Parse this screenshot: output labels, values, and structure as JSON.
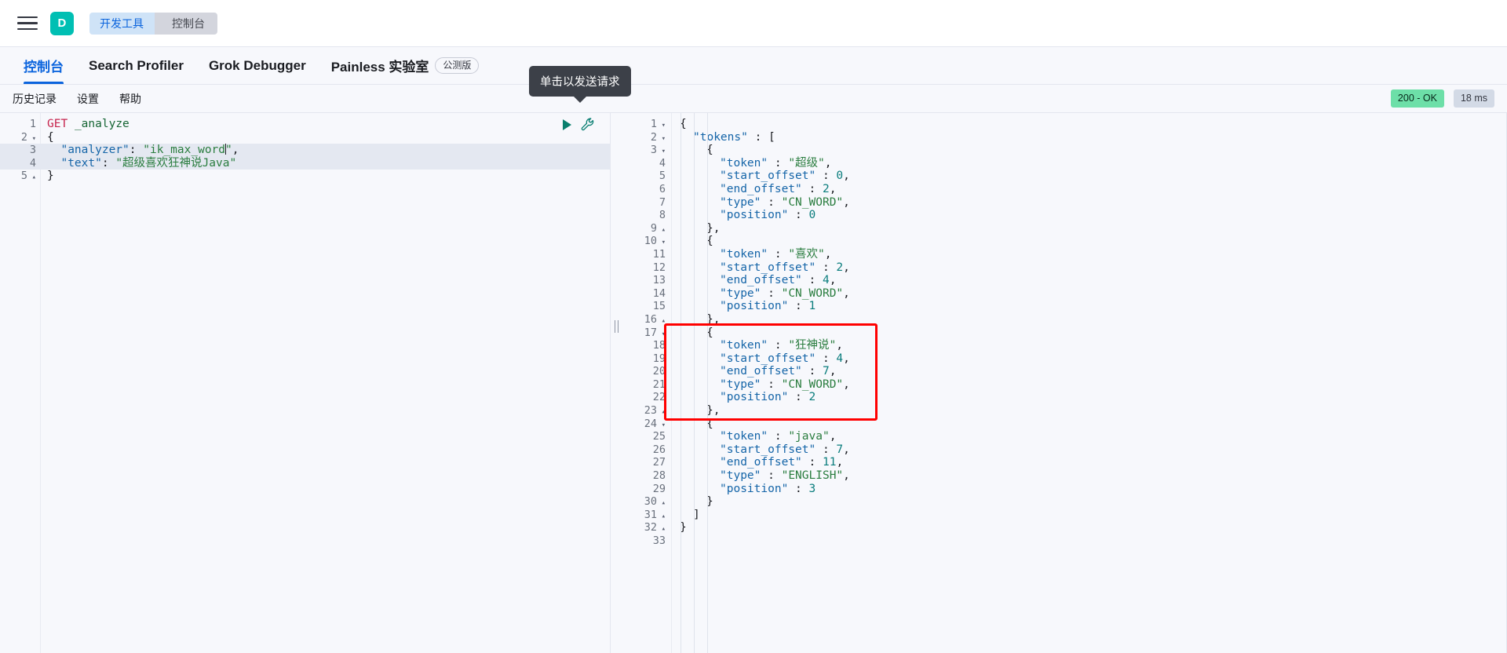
{
  "chrome": {
    "menu_icon": "hamburger-menu-icon",
    "avatar_initial": "D",
    "breadcrumbs": [
      {
        "label": "开发工具",
        "active": true
      },
      {
        "label": "控制台",
        "active": false
      }
    ]
  },
  "app_tabs": [
    {
      "label": "控制台",
      "active": true,
      "badge": ""
    },
    {
      "label": "Search Profiler",
      "active": false,
      "badge": ""
    },
    {
      "label": "Grok Debugger",
      "active": false,
      "badge": ""
    },
    {
      "label": "Painless 实验室",
      "active": false,
      "badge": "公测版"
    }
  ],
  "subbar": {
    "items": [
      {
        "label": "历史记录"
      },
      {
        "label": "设置"
      },
      {
        "label": "帮助"
      }
    ],
    "status_code": "200 - OK",
    "duration": "18 ms",
    "status_color": "#6ddfa8",
    "duration_color": "#d3dae6"
  },
  "tooltip": {
    "text": "单击以发送请求"
  },
  "editor_actions": {
    "play_label": "send-request",
    "wrench_label": "open-documentation"
  },
  "request_editor": {
    "lines": [
      {
        "n": "1",
        "fold": "",
        "hl": false,
        "segments": [
          {
            "t": "GET",
            "c": "k-method"
          },
          {
            "t": " ",
            "c": "k-punc"
          },
          {
            "t": "_analyze",
            "c": "k-url"
          }
        ]
      },
      {
        "n": "2",
        "fold": "▾",
        "hl": false,
        "segments": [
          {
            "t": "{",
            "c": "k-brace"
          }
        ]
      },
      {
        "n": "3",
        "fold": "",
        "hl": true,
        "segments": [
          {
            "t": "  ",
            "c": "k-punc"
          },
          {
            "t": "\"analyzer\"",
            "c": "k-key"
          },
          {
            "t": ": ",
            "c": "k-punc"
          },
          {
            "t": "\"ik_max_word",
            "c": "k-str"
          },
          {
            "t": "CARET",
            "c": "caret"
          },
          {
            "t": "\"",
            "c": "k-str"
          },
          {
            "t": ",",
            "c": "k-punc"
          }
        ]
      },
      {
        "n": "4",
        "fold": "",
        "hl": true,
        "segments": [
          {
            "t": "  ",
            "c": "k-punc"
          },
          {
            "t": "\"text\"",
            "c": "k-key"
          },
          {
            "t": ": ",
            "c": "k-punc"
          },
          {
            "t": "\"超级喜欢狂神说Java\"",
            "c": "k-str"
          }
        ]
      },
      {
        "n": "5",
        "fold": "▴",
        "hl": false,
        "segments": [
          {
            "t": "}",
            "c": "k-brace"
          }
        ]
      }
    ]
  },
  "response_editor": {
    "lines": [
      {
        "n": "1",
        "fold": "▾",
        "indent": 0,
        "segments": [
          {
            "t": "{",
            "c": "k-brace"
          }
        ]
      },
      {
        "n": "2",
        "fold": "▾",
        "indent": 1,
        "segments": [
          {
            "t": "\"tokens\"",
            "c": "k-key"
          },
          {
            "t": " : ",
            "c": "k-punc"
          },
          {
            "t": "[",
            "c": "k-brace"
          }
        ]
      },
      {
        "n": "3",
        "fold": "▾",
        "indent": 2,
        "segments": [
          {
            "t": "{",
            "c": "k-brace"
          }
        ]
      },
      {
        "n": "4",
        "fold": "",
        "indent": 3,
        "segments": [
          {
            "t": "\"token\"",
            "c": "k-key"
          },
          {
            "t": " : ",
            "c": "k-punc"
          },
          {
            "t": "\"超级\"",
            "c": "k-str"
          },
          {
            "t": ",",
            "c": "k-punc"
          }
        ]
      },
      {
        "n": "5",
        "fold": "",
        "indent": 3,
        "segments": [
          {
            "t": "\"start_offset\"",
            "c": "k-key"
          },
          {
            "t": " : ",
            "c": "k-punc"
          },
          {
            "t": "0",
            "c": "k-num"
          },
          {
            "t": ",",
            "c": "k-punc"
          }
        ]
      },
      {
        "n": "6",
        "fold": "",
        "indent": 3,
        "segments": [
          {
            "t": "\"end_offset\"",
            "c": "k-key"
          },
          {
            "t": " : ",
            "c": "k-punc"
          },
          {
            "t": "2",
            "c": "k-num"
          },
          {
            "t": ",",
            "c": "k-punc"
          }
        ]
      },
      {
        "n": "7",
        "fold": "",
        "indent": 3,
        "segments": [
          {
            "t": "\"type\"",
            "c": "k-key"
          },
          {
            "t": " : ",
            "c": "k-punc"
          },
          {
            "t": "\"CN_WORD\"",
            "c": "k-str"
          },
          {
            "t": ",",
            "c": "k-punc"
          }
        ]
      },
      {
        "n": "8",
        "fold": "",
        "indent": 3,
        "segments": [
          {
            "t": "\"position\"",
            "c": "k-key"
          },
          {
            "t": " : ",
            "c": "k-punc"
          },
          {
            "t": "0",
            "c": "k-num"
          }
        ]
      },
      {
        "n": "9",
        "fold": "▴",
        "indent": 2,
        "segments": [
          {
            "t": "},",
            "c": "k-brace"
          }
        ]
      },
      {
        "n": "10",
        "fold": "▾",
        "indent": 2,
        "segments": [
          {
            "t": "{",
            "c": "k-brace"
          }
        ]
      },
      {
        "n": "11",
        "fold": "",
        "indent": 3,
        "segments": [
          {
            "t": "\"token\"",
            "c": "k-key"
          },
          {
            "t": " : ",
            "c": "k-punc"
          },
          {
            "t": "\"喜欢\"",
            "c": "k-str"
          },
          {
            "t": ",",
            "c": "k-punc"
          }
        ]
      },
      {
        "n": "12",
        "fold": "",
        "indent": 3,
        "segments": [
          {
            "t": "\"start_offset\"",
            "c": "k-key"
          },
          {
            "t": " : ",
            "c": "k-punc"
          },
          {
            "t": "2",
            "c": "k-num"
          },
          {
            "t": ",",
            "c": "k-punc"
          }
        ]
      },
      {
        "n": "13",
        "fold": "",
        "indent": 3,
        "segments": [
          {
            "t": "\"end_offset\"",
            "c": "k-key"
          },
          {
            "t": " : ",
            "c": "k-punc"
          },
          {
            "t": "4",
            "c": "k-num"
          },
          {
            "t": ",",
            "c": "k-punc"
          }
        ]
      },
      {
        "n": "14",
        "fold": "",
        "indent": 3,
        "segments": [
          {
            "t": "\"type\"",
            "c": "k-key"
          },
          {
            "t": " : ",
            "c": "k-punc"
          },
          {
            "t": "\"CN_WORD\"",
            "c": "k-str"
          },
          {
            "t": ",",
            "c": "k-punc"
          }
        ]
      },
      {
        "n": "15",
        "fold": "",
        "indent": 3,
        "segments": [
          {
            "t": "\"position\"",
            "c": "k-key"
          },
          {
            "t": " : ",
            "c": "k-punc"
          },
          {
            "t": "1",
            "c": "k-num"
          }
        ]
      },
      {
        "n": "16",
        "fold": "▴",
        "indent": 2,
        "segments": [
          {
            "t": "},",
            "c": "k-brace"
          }
        ]
      },
      {
        "n": "17",
        "fold": "▾",
        "indent": 2,
        "segments": [
          {
            "t": "{",
            "c": "k-brace"
          }
        ]
      },
      {
        "n": "18",
        "fold": "",
        "indent": 3,
        "segments": [
          {
            "t": "\"token\"",
            "c": "k-key"
          },
          {
            "t": " : ",
            "c": "k-punc"
          },
          {
            "t": "\"狂神说\"",
            "c": "k-str"
          },
          {
            "t": ",",
            "c": "k-punc"
          }
        ]
      },
      {
        "n": "19",
        "fold": "",
        "indent": 3,
        "segments": [
          {
            "t": "\"start_offset\"",
            "c": "k-key"
          },
          {
            "t": " : ",
            "c": "k-punc"
          },
          {
            "t": "4",
            "c": "k-num"
          },
          {
            "t": ",",
            "c": "k-punc"
          }
        ]
      },
      {
        "n": "20",
        "fold": "",
        "indent": 3,
        "segments": [
          {
            "t": "\"end_offset\"",
            "c": "k-key"
          },
          {
            "t": " : ",
            "c": "k-punc"
          },
          {
            "t": "7",
            "c": "k-num"
          },
          {
            "t": ",",
            "c": "k-punc"
          }
        ]
      },
      {
        "n": "21",
        "fold": "",
        "indent": 3,
        "segments": [
          {
            "t": "\"type\"",
            "c": "k-key"
          },
          {
            "t": " : ",
            "c": "k-punc"
          },
          {
            "t": "\"CN_WORD\"",
            "c": "k-str"
          },
          {
            "t": ",",
            "c": "k-punc"
          }
        ]
      },
      {
        "n": "22",
        "fold": "",
        "indent": 3,
        "segments": [
          {
            "t": "\"position\"",
            "c": "k-key"
          },
          {
            "t": " : ",
            "c": "k-punc"
          },
          {
            "t": "2",
            "c": "k-num"
          }
        ]
      },
      {
        "n": "23",
        "fold": "▴",
        "indent": 2,
        "segments": [
          {
            "t": "},",
            "c": "k-brace"
          }
        ]
      },
      {
        "n": "24",
        "fold": "▾",
        "indent": 2,
        "segments": [
          {
            "t": "{",
            "c": "k-brace"
          }
        ]
      },
      {
        "n": "25",
        "fold": "",
        "indent": 3,
        "segments": [
          {
            "t": "\"token\"",
            "c": "k-key"
          },
          {
            "t": " : ",
            "c": "k-punc"
          },
          {
            "t": "\"java\"",
            "c": "k-str"
          },
          {
            "t": ",",
            "c": "k-punc"
          }
        ]
      },
      {
        "n": "26",
        "fold": "",
        "indent": 3,
        "segments": [
          {
            "t": "\"start_offset\"",
            "c": "k-key"
          },
          {
            "t": " : ",
            "c": "k-punc"
          },
          {
            "t": "7",
            "c": "k-num"
          },
          {
            "t": ",",
            "c": "k-punc"
          }
        ]
      },
      {
        "n": "27",
        "fold": "",
        "indent": 3,
        "segments": [
          {
            "t": "\"end_offset\"",
            "c": "k-key"
          },
          {
            "t": " : ",
            "c": "k-punc"
          },
          {
            "t": "11",
            "c": "k-num"
          },
          {
            "t": ",",
            "c": "k-punc"
          }
        ]
      },
      {
        "n": "28",
        "fold": "",
        "indent": 3,
        "segments": [
          {
            "t": "\"type\"",
            "c": "k-key"
          },
          {
            "t": " : ",
            "c": "k-punc"
          },
          {
            "t": "\"ENGLISH\"",
            "c": "k-str"
          },
          {
            "t": ",",
            "c": "k-punc"
          }
        ]
      },
      {
        "n": "29",
        "fold": "",
        "indent": 3,
        "segments": [
          {
            "t": "\"position\"",
            "c": "k-key"
          },
          {
            "t": " : ",
            "c": "k-punc"
          },
          {
            "t": "3",
            "c": "k-num"
          }
        ]
      },
      {
        "n": "30",
        "fold": "▴",
        "indent": 2,
        "segments": [
          {
            "t": "}",
            "c": "k-brace"
          }
        ]
      },
      {
        "n": "31",
        "fold": "▴",
        "indent": 1,
        "segments": [
          {
            "t": "]",
            "c": "k-brace"
          }
        ]
      },
      {
        "n": "32",
        "fold": "▴",
        "indent": 0,
        "segments": [
          {
            "t": "}",
            "c": "k-brace"
          }
        ]
      },
      {
        "n": "33",
        "fold": "",
        "indent": 0,
        "segments": [
          {
            "t": "",
            "c": "k-punc"
          }
        ]
      }
    ]
  },
  "annotation": {
    "rect_color": "#ff0000",
    "covers_lines": "17-23"
  }
}
